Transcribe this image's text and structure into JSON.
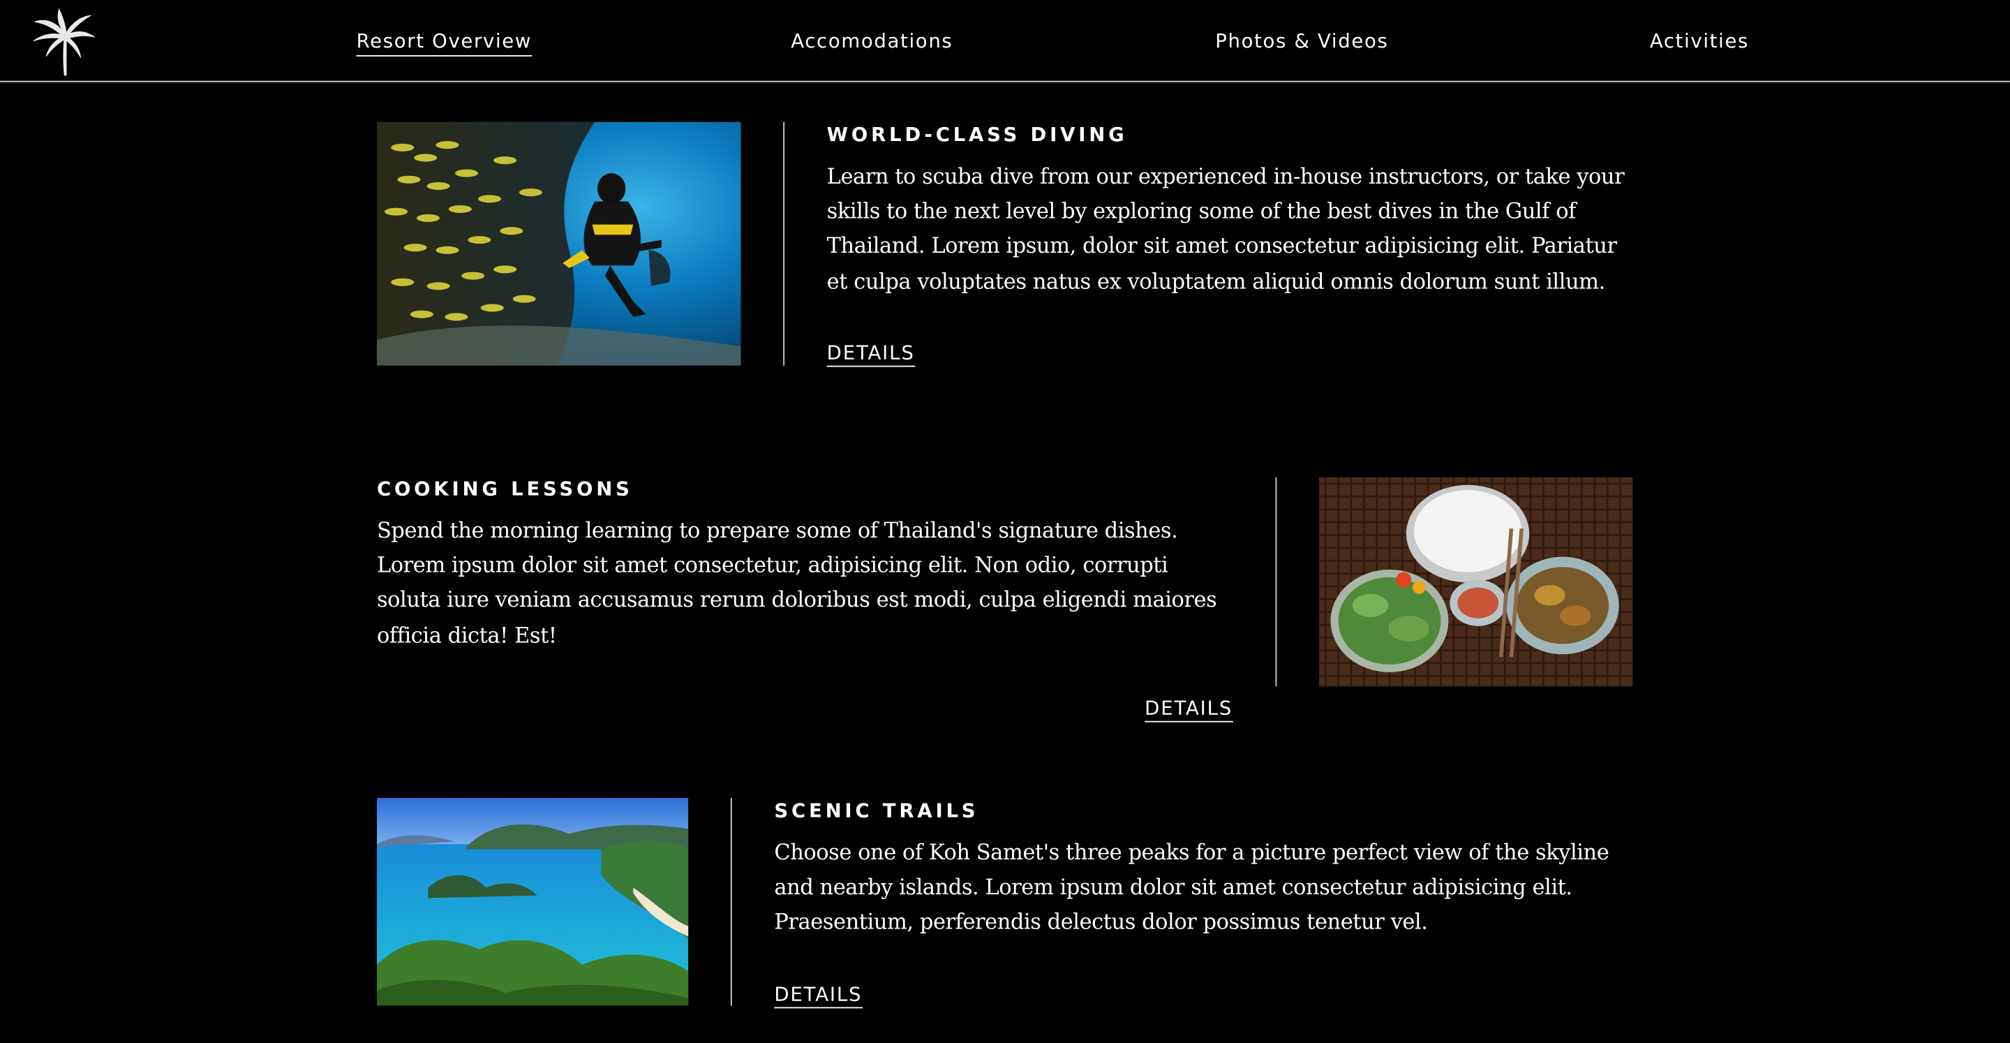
{
  "nav": {
    "logo_icon": "palm-tree-icon",
    "links": [
      {
        "label": "Resort Overview",
        "active": true
      },
      {
        "label": "Accomodations",
        "active": false
      },
      {
        "label": "Photos & Videos",
        "active": false
      },
      {
        "label": "Activities",
        "active": false
      }
    ]
  },
  "activities": [
    {
      "title": "WORLD-CLASS DIVING",
      "description": "Learn to scuba dive from our experienced in-house instructors, or take your skills to the next level by exploring some of the best dives in the Gulf of Thailand. Lorem ipsum, dolor sit amet consectetur adipisicing elit. Pariatur et culpa voluptates natus ex voluptatem aliquid omnis dolorum sunt illum.",
      "details_label": "DETAILS",
      "image": "scuba-diver-with-fish-school-photo"
    },
    {
      "title": "COOKING LESSONS",
      "description": "Spend the morning learning to prepare some of Thailand's signature dishes. Lorem ipsum dolor sit amet consectetur, adipisicing elit. Non odio, corrupti soluta iure veniam accusamus rerum doloribus est modi, culpa eligendi maiores officia dicta! Est!",
      "details_label": "DETAILS",
      "image": "thai-food-platter-photo"
    },
    {
      "title": "SCENIC TRAILS",
      "description": "Choose one of Koh Samet's three peaks for a picture perfect view of the skyline and nearby islands. Lorem ipsum dolor sit amet consectetur adipisicing elit. Praesentium, perferendis delectus dolor possimus tenetur vel.",
      "details_label": "DETAILS",
      "image": "tropical-bay-islands-photo"
    }
  ],
  "colors": {
    "background": "#000000",
    "text": "#ffffff",
    "divider": "#d0d0d0"
  }
}
